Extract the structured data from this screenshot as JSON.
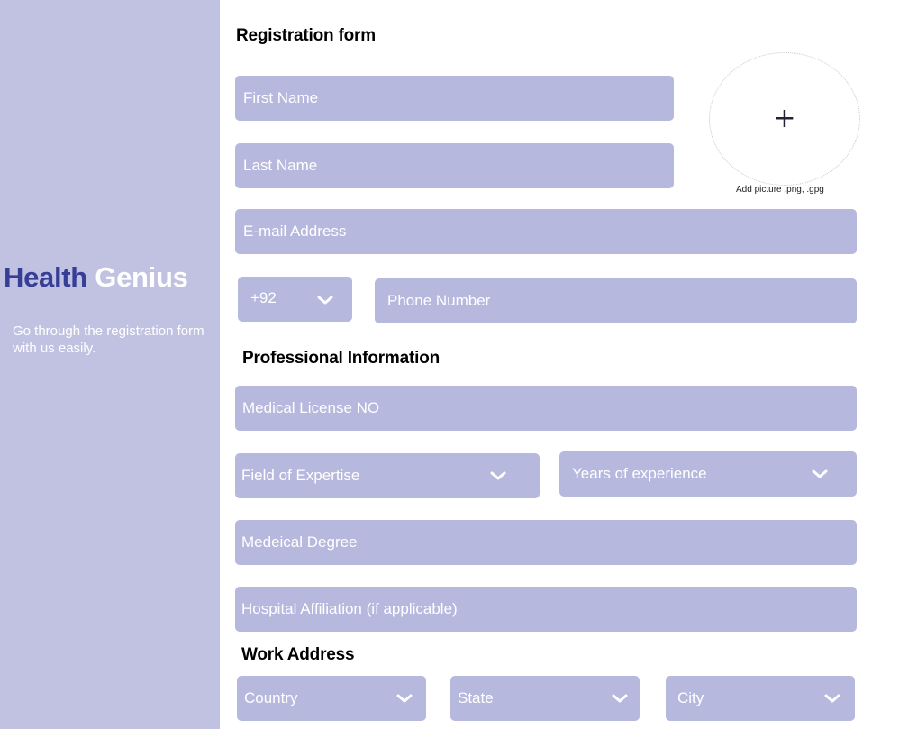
{
  "sidebar": {
    "brand_part1": "Health",
    "brand_part2": "Genius",
    "tagline": "Go through the registration form with us easily."
  },
  "form": {
    "title": "Registration form",
    "first_name_placeholder": "First Name",
    "last_name_placeholder": "Last Name",
    "email_placeholder": "E-mail Address",
    "country_code": "+92",
    "phone_placeholder": "Phone Number",
    "photo": {
      "add_symbol": "+",
      "label": "Add picture  .png, .gpg"
    }
  },
  "professional": {
    "title": "Professional Information",
    "license_placeholder": "Medical License NO",
    "expertise_placeholder": "Field of Expertise",
    "experience_placeholder": "Years of experience",
    "degree_placeholder": "Medeical Degree",
    "hospital_placeholder": "Hospital Affiliation (if applicable)"
  },
  "work_address": {
    "title": "Work  Address",
    "country_placeholder": "Country",
    "state_placeholder": "State",
    "city_placeholder": "City"
  },
  "colors": {
    "sidebar_bg": "#c1c2e2",
    "field_bg": "#b6b8dd",
    "brand_accent": "#363f95"
  },
  "icons": {
    "dropdown": "chevron-down-icon",
    "add_photo": "plus-icon"
  }
}
